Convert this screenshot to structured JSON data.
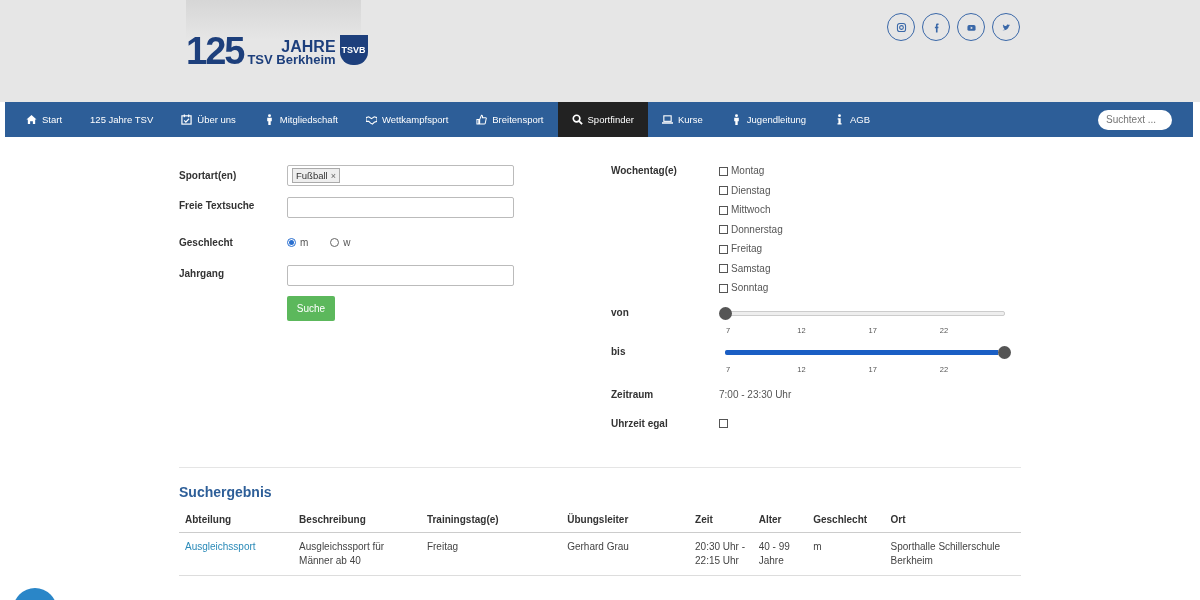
{
  "header": {
    "logo": {
      "number": "125",
      "word": "JAHRE",
      "club": "TSV Berkheim",
      "badge": "TSVB"
    },
    "social": [
      {
        "kind": "instagram"
      },
      {
        "kind": "facebook"
      },
      {
        "kind": "youtube"
      },
      {
        "kind": "twitter"
      }
    ]
  },
  "nav": {
    "items": [
      {
        "label": "Start",
        "selected": false
      },
      {
        "label": "125 Jahre TSV",
        "selected": false
      },
      {
        "label": "Über uns",
        "selected": false
      },
      {
        "label": "Mitgliedschaft",
        "selected": false
      },
      {
        "label": "Wettkampfsport",
        "selected": false
      },
      {
        "label": "Breitensport",
        "selected": false
      },
      {
        "label": "Sportfinder",
        "selected": true
      },
      {
        "label": "Kurse",
        "selected": false
      },
      {
        "label": "Jugendleitung",
        "selected": false
      },
      {
        "label": "AGB",
        "selected": false
      }
    ],
    "search": {
      "placeholder": "Suchtext ..."
    }
  },
  "form": {
    "sport": {
      "label": "Sportart(en)",
      "tags": [
        "Fußball"
      ],
      "remove": "×"
    },
    "text_search": {
      "label": "Freie Textsuche"
    },
    "gender": {
      "label": "Geschlecht",
      "options": [
        {
          "label": "m",
          "selected": true
        },
        {
          "label": "w",
          "selected": false
        }
      ]
    },
    "year": {
      "label": "Jahrgang"
    },
    "submit": "Suche",
    "weekdays": {
      "label": "Wochentag(e)",
      "days": [
        {
          "label": "Montag",
          "checked": false
        },
        {
          "label": "Dienstag",
          "checked": false
        },
        {
          "label": "Mittwoch",
          "checked": false
        },
        {
          "label": "Donnerstag",
          "checked": false
        },
        {
          "label": "Freitag",
          "checked": false
        },
        {
          "label": "Samstag",
          "checked": false
        },
        {
          "label": "Sonntag",
          "checked": false
        }
      ]
    },
    "sliders": [
      {
        "label": "von",
        "level": 0,
        "ticks": [
          "7",
          "12",
          "17",
          "22"
        ]
      },
      {
        "label": "bis",
        "level": 1,
        "ticks": [
          "7",
          "12",
          "17",
          "22"
        ]
      }
    ],
    "period": {
      "label": "Zeitraum",
      "value": "7:00 - 23:30 Uhr"
    },
    "any_time": {
      "label": "Uhrzeit egal",
      "checked": false
    }
  },
  "results": {
    "title": "Suchergebnis",
    "columns": [
      "Abteilung",
      "Beschreibung",
      "Trainingstag(e)",
      "Übungsleiter",
      "Zeit",
      "Alter",
      "Geschlecht",
      "Ort"
    ],
    "rows": [
      [
        "Ausgleichssport",
        "Ausgleichssport für Männer ab 40",
        "Freitag",
        "Gerhard Grau",
        "20:30 Uhr - 22:15 Uhr",
        "40 - 99 Jahre",
        "m",
        "Sporthalle Schillerschule Berkheim"
      ]
    ]
  }
}
